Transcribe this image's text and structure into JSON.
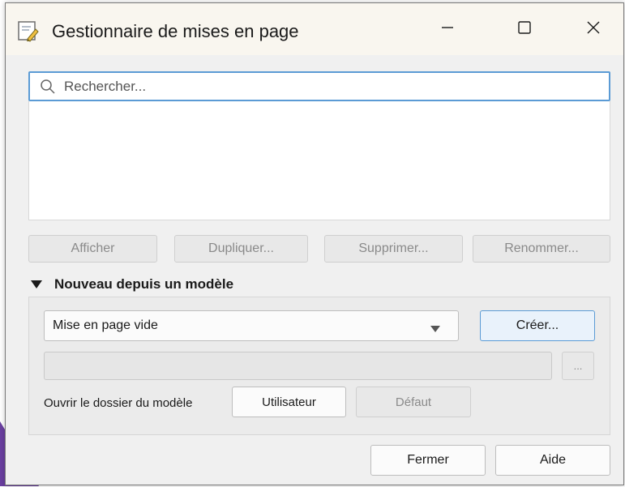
{
  "window": {
    "title": "Gestionnaire de mises en page",
    "controls": {
      "minimize": "—",
      "maximize": "☐",
      "close": "✕"
    }
  },
  "search": {
    "placeholder": "Rechercher...",
    "value": ""
  },
  "actions": {
    "afficher": "Afficher",
    "dupliquer": "Dupliquer...",
    "supprimer": "Supprimer...",
    "renommer": "Renommer..."
  },
  "template_section": {
    "title": "Nouveau depuis un modèle",
    "expanded": true,
    "template_select": "Mise en page vide",
    "create_label": "Créer...",
    "path_value": "",
    "browse_label": "...",
    "open_folder_label": "Ouvrir le dossier du modèle",
    "user_label": "Utilisateur",
    "default_label": "Défaut"
  },
  "footer": {
    "close_label": "Fermer",
    "help_label": "Aide"
  },
  "colors": {
    "accent": "#5b9bd5",
    "titlebar": "#f9f6ef",
    "dialog_bg": "#f0f0f0",
    "desktop_shape": "#6a3fa0"
  }
}
